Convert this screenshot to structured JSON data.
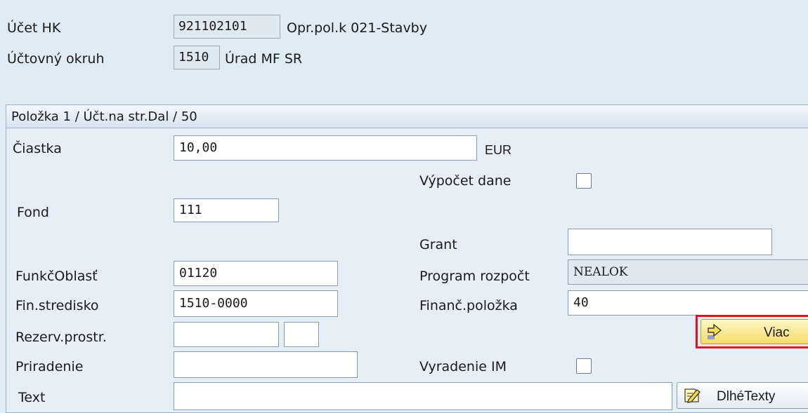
{
  "header": {
    "gl_account": {
      "label": "Účet HK",
      "value": "921102101",
      "description": "Opr.pol.k 021-Stavby"
    },
    "company_code": {
      "label": "Účtovný okruh",
      "value": "1510",
      "description": "Úrad MF SR"
    }
  },
  "item_panel": {
    "title": "Položka 1 / Účt.na str.Dal / 50",
    "fields": {
      "amount": {
        "label": "Čiastka",
        "value": "10,00",
        "currency": "EUR"
      },
      "tax_calc": {
        "label": "Výpočet dane",
        "checked": false
      },
      "fund": {
        "label": "Fond",
        "value": "111"
      },
      "grant": {
        "label": "Grant",
        "value": ""
      },
      "functional_area": {
        "label": "FunkčOblasť",
        "value": "01120"
      },
      "budget_program": {
        "label": "Program rozpočt",
        "value": "NEALOK"
      },
      "fund_center": {
        "label": "Fin.stredisko",
        "value": "1510-0000"
      },
      "commitment_item": {
        "label": "Finanč.položka",
        "value": "40"
      },
      "earmarked_funds": {
        "label": "Rezerv.prostr.",
        "value": "",
        "value2": ""
      },
      "assignment": {
        "label": "Priradenie",
        "value": ""
      },
      "asset_retirement": {
        "label": "Vyradenie IM",
        "checked": false
      },
      "text": {
        "label": "Text",
        "value": ""
      }
    },
    "buttons": {
      "more": "Viac",
      "long_texts": "DlhéTexty"
    }
  },
  "colors": {
    "background": "#dfebf5",
    "highlight": "#e0141e"
  }
}
